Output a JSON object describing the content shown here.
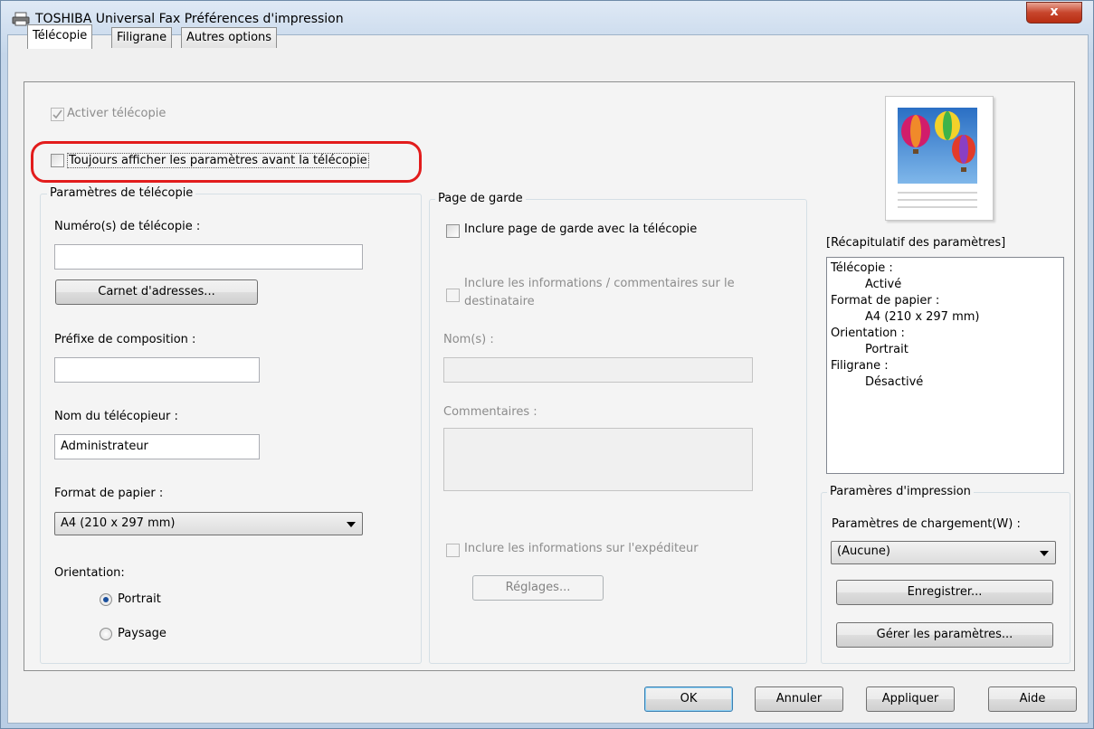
{
  "window": {
    "title": "TOSHIBA Universal Fax Préférences d'impression",
    "close_label": "x"
  },
  "tabs": [
    {
      "label": "Télécopie",
      "active": true
    },
    {
      "label": "Filigrane",
      "active": false
    },
    {
      "label": "Autres options",
      "active": false
    }
  ],
  "fax": {
    "activate_label": "Activer télécopie",
    "activate_checked": true,
    "always_show_label": "Toujours afficher les paramètres avant la télécopie",
    "always_show_checked": false
  },
  "fax_params": {
    "legend": "Paramètres de télécopie",
    "fax_numbers_label": "Numéro(s) de télécopie :",
    "fax_numbers_value": "",
    "address_book_button": "Carnet d'adresses...",
    "dial_prefix_label": "Préfixe de composition :",
    "dial_prefix_value": "",
    "sender_name_label": "Nom du télécopieur :",
    "sender_name_value": "Administrateur",
    "paper_size_label": "Format de papier :",
    "paper_size_value": "A4 (210 x 297 mm)",
    "orientation_label": "Orientation:",
    "portrait_label": "Portrait",
    "landscape_label": "Paysage",
    "orientation_selected": "Portrait"
  },
  "cover": {
    "legend": "Page de garde",
    "include_cover_label": "Inclure page de garde avec la télécopie",
    "include_recipient_label_1": "Inclure les informations / commentaires sur le",
    "include_recipient_label_2": "destinataire",
    "names_label": "Nom(s) :",
    "comments_label": "Commentaires :",
    "include_sender_label": "Inclure les informations sur l'expéditeur",
    "settings_button": "Réglages..."
  },
  "summary": {
    "header": "[Récapitulatif des paramètres]",
    "lines": [
      {
        "text": "Télécopie :",
        "indent": false
      },
      {
        "text": "Activé",
        "indent": true
      },
      {
        "text": "Format de papier :",
        "indent": false
      },
      {
        "text": "A4 (210 x 297 mm)",
        "indent": true
      },
      {
        "text": "Orientation :",
        "indent": false
      },
      {
        "text": "Portrait",
        "indent": true
      },
      {
        "text": "Filigrane :",
        "indent": false
      },
      {
        "text": "Désactivé",
        "indent": true
      }
    ]
  },
  "print_params": {
    "legend": "Paramères d'impression",
    "load_label": "Paramètres de chargement(W) :",
    "load_value": "(Aucune)",
    "save_button": "Enregistrer...",
    "manage_button": "Gérer les paramètres..."
  },
  "footer": {
    "ok": "OK",
    "cancel": "Annuler",
    "apply": "Appliquer",
    "help": "Aide"
  },
  "colors": {
    "highlight": "#e21c1c",
    "default_button_border": "#3c7fb1"
  }
}
